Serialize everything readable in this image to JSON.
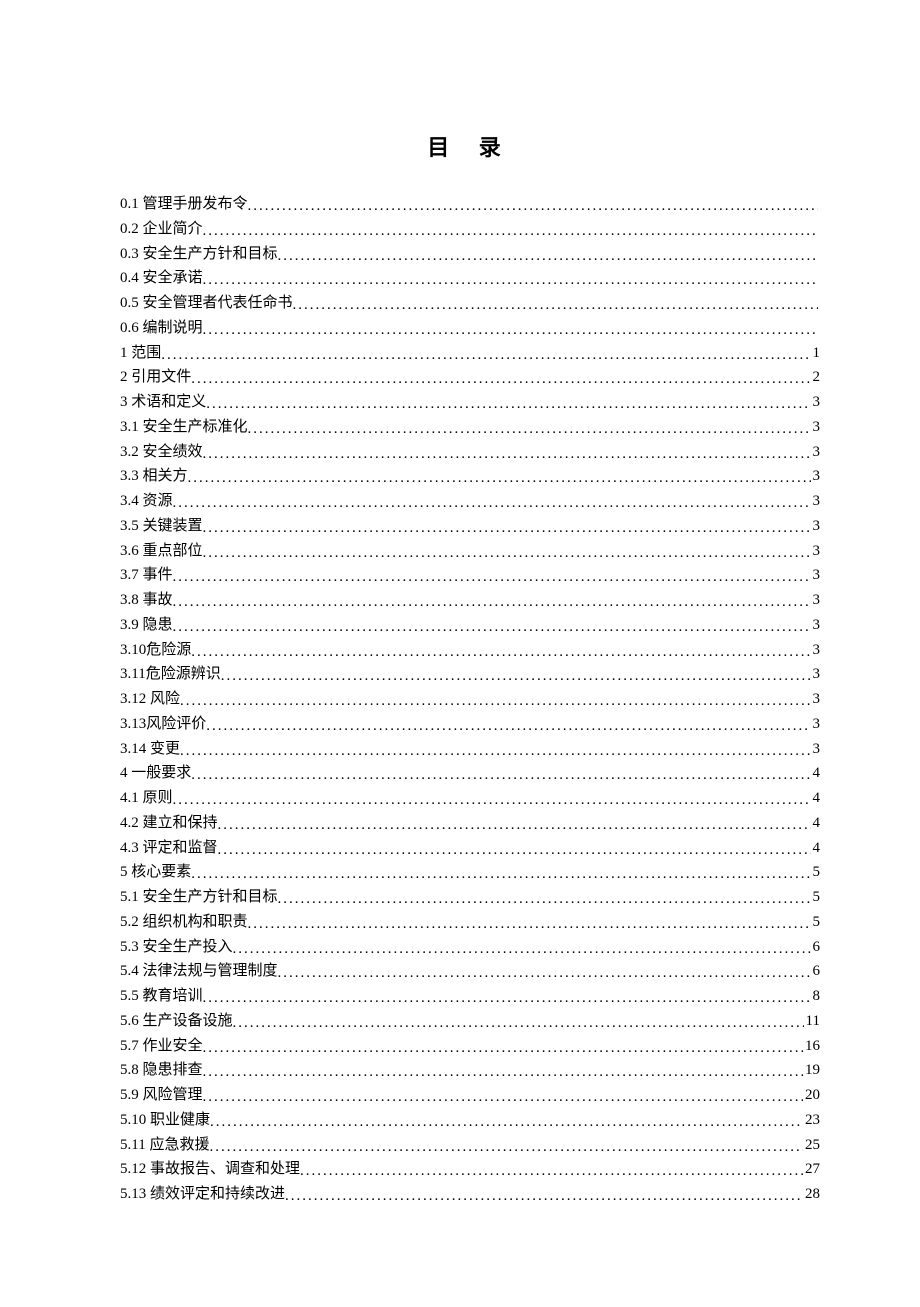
{
  "title": "目 录",
  "entries": [
    {
      "label": "0.1 管理手册发布令",
      "page": ""
    },
    {
      "label": "0.2 企业简介",
      "page": ""
    },
    {
      "label": "0.3 安全生产方针和目标",
      "page": ""
    },
    {
      "label": "0.4 安全承诺",
      "page": ""
    },
    {
      "label": "0.5 安全管理者代表任命书",
      "page": ""
    },
    {
      "label": "0.6 编制说明",
      "page": ""
    },
    {
      "label": "1   范围 ",
      "page": " 1"
    },
    {
      "label": "2   引用文件 ",
      "page": " 2"
    },
    {
      "label": "3   术语和定义 ",
      "page": " 3"
    },
    {
      "label": "3.1 安全生产标准化",
      "page": " 3"
    },
    {
      "label": "3.2 安全绩效",
      "page": " 3"
    },
    {
      "label": "3.3 相关方",
      "page": " 3"
    },
    {
      "label": "3.4 资源",
      "page": " 3"
    },
    {
      "label": "3.5 关键装置",
      "page": " 3"
    },
    {
      "label": "3.6 重点部位",
      "page": " 3"
    },
    {
      "label": "3.7 事件",
      "page": " 3"
    },
    {
      "label": "3.8 事故",
      "page": " 3"
    },
    {
      "label": "3.9 隐患",
      "page": " 3"
    },
    {
      "label": "3.10危险源",
      "page": " 3"
    },
    {
      "label": "3.11危险源辨识",
      "page": " 3"
    },
    {
      "label": "3.12 风险",
      "page": " 3"
    },
    {
      "label": "3.13风险评价",
      "page": " 3"
    },
    {
      "label": "3.14 变更",
      "page": " 3"
    },
    {
      "label": "4   一般要求 ",
      "page": " 4"
    },
    {
      "label": "4.1 原则",
      "page": " 4"
    },
    {
      "label": "4.2 建立和保持",
      "page": "4"
    },
    {
      "label": "4.3 评定和监督",
      "page": "4"
    },
    {
      "label": "5   核心要素",
      "page": " 5"
    },
    {
      "label": "5.1 安全生产方针和目标",
      "page": " 5"
    },
    {
      "label": "5.2 组织机构和职责",
      "page": "5"
    },
    {
      "label": "5.3 安全生产投入",
      "page": "6"
    },
    {
      "label": "5.4 法律法规与管理制度",
      "page": " 6"
    },
    {
      "label": "5.5 教育培训",
      "page": " 8"
    },
    {
      "label": "5.6 生产设备设施",
      "page": "11"
    },
    {
      "label": "5.7 作业安全",
      "page": "16"
    },
    {
      "label": "5.8 隐患排查",
      "page": "19"
    },
    {
      "label": "5.9 风险管理",
      "page": "20"
    },
    {
      "label": "5.10 职业健康",
      "page": "23"
    },
    {
      "label": "5.11 应急救援",
      "page": "25"
    },
    {
      "label": "5.12 事故报告、调查和处理",
      "page": "27"
    },
    {
      "label": "5.13 绩效评定和持续改进",
      "page": "28"
    }
  ]
}
